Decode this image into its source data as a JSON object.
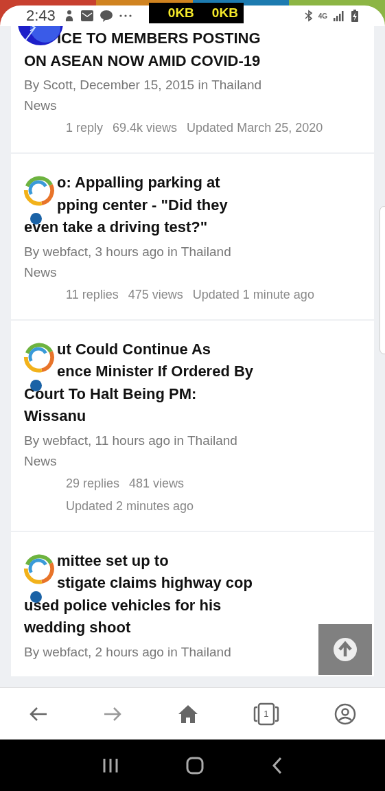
{
  "status_bar": {
    "time": "2:43",
    "speeds": [
      "0KB",
      "0KB"
    ],
    "network": "4G"
  },
  "topics": [
    {
      "kind": "lightning",
      "title_lines": [
        {
          "text": "ICE TO MEMBERS POSTING",
          "indented": true
        },
        {
          "text": "ON ASEAN NOW AMID COVID-19",
          "indented": false
        }
      ],
      "unread": false,
      "meta_lines": [
        "By Scott, December 15, 2015 in Thailand",
        "News"
      ],
      "stat_rows": [
        [
          "1 reply",
          "69.4k views",
          "Updated March 25, 2020"
        ]
      ]
    },
    {
      "kind": "logo",
      "title_lines": [
        {
          "text": "o: Appalling parking at",
          "indented": true
        },
        {
          "text": "pping center - \"Did they",
          "indented": true
        },
        {
          "text": "even take a driving test?\"",
          "indented": false
        }
      ],
      "unread": true,
      "meta_lines": [
        "By webfact, 3 hours ago in Thailand",
        "News"
      ],
      "stat_rows": [
        [
          "11 replies",
          "475 views",
          "Updated 1 minute ago"
        ]
      ]
    },
    {
      "kind": "logo",
      "title_lines": [
        {
          "text": "ut Could Continue As",
          "indented": true
        },
        {
          "text": "ence Minister If Ordered By",
          "indented": true
        },
        {
          "text": "Court To Halt Being PM:",
          "indented": false
        },
        {
          "text": "Wissanu",
          "indented": false
        }
      ],
      "unread": true,
      "meta_lines": [
        "By webfact, 11 hours ago in Thailand",
        "News"
      ],
      "stat_rows": [
        [
          "29 replies",
          "481 views"
        ],
        [
          "Updated 2 minutes ago"
        ]
      ]
    },
    {
      "kind": "logo",
      "title_lines": [
        {
          "text": "mittee set up to",
          "indented": true
        },
        {
          "text": "stigate claims highway cop",
          "indented": true
        },
        {
          "text": "used police vehicles for his",
          "indented": false
        },
        {
          "text": "wedding shoot",
          "indented": false
        }
      ],
      "unread": true,
      "meta_lines": [
        "By webfact, 2 hours ago in Thailand"
      ]
    }
  ],
  "browser_bar": {
    "tab_count": "1"
  }
}
